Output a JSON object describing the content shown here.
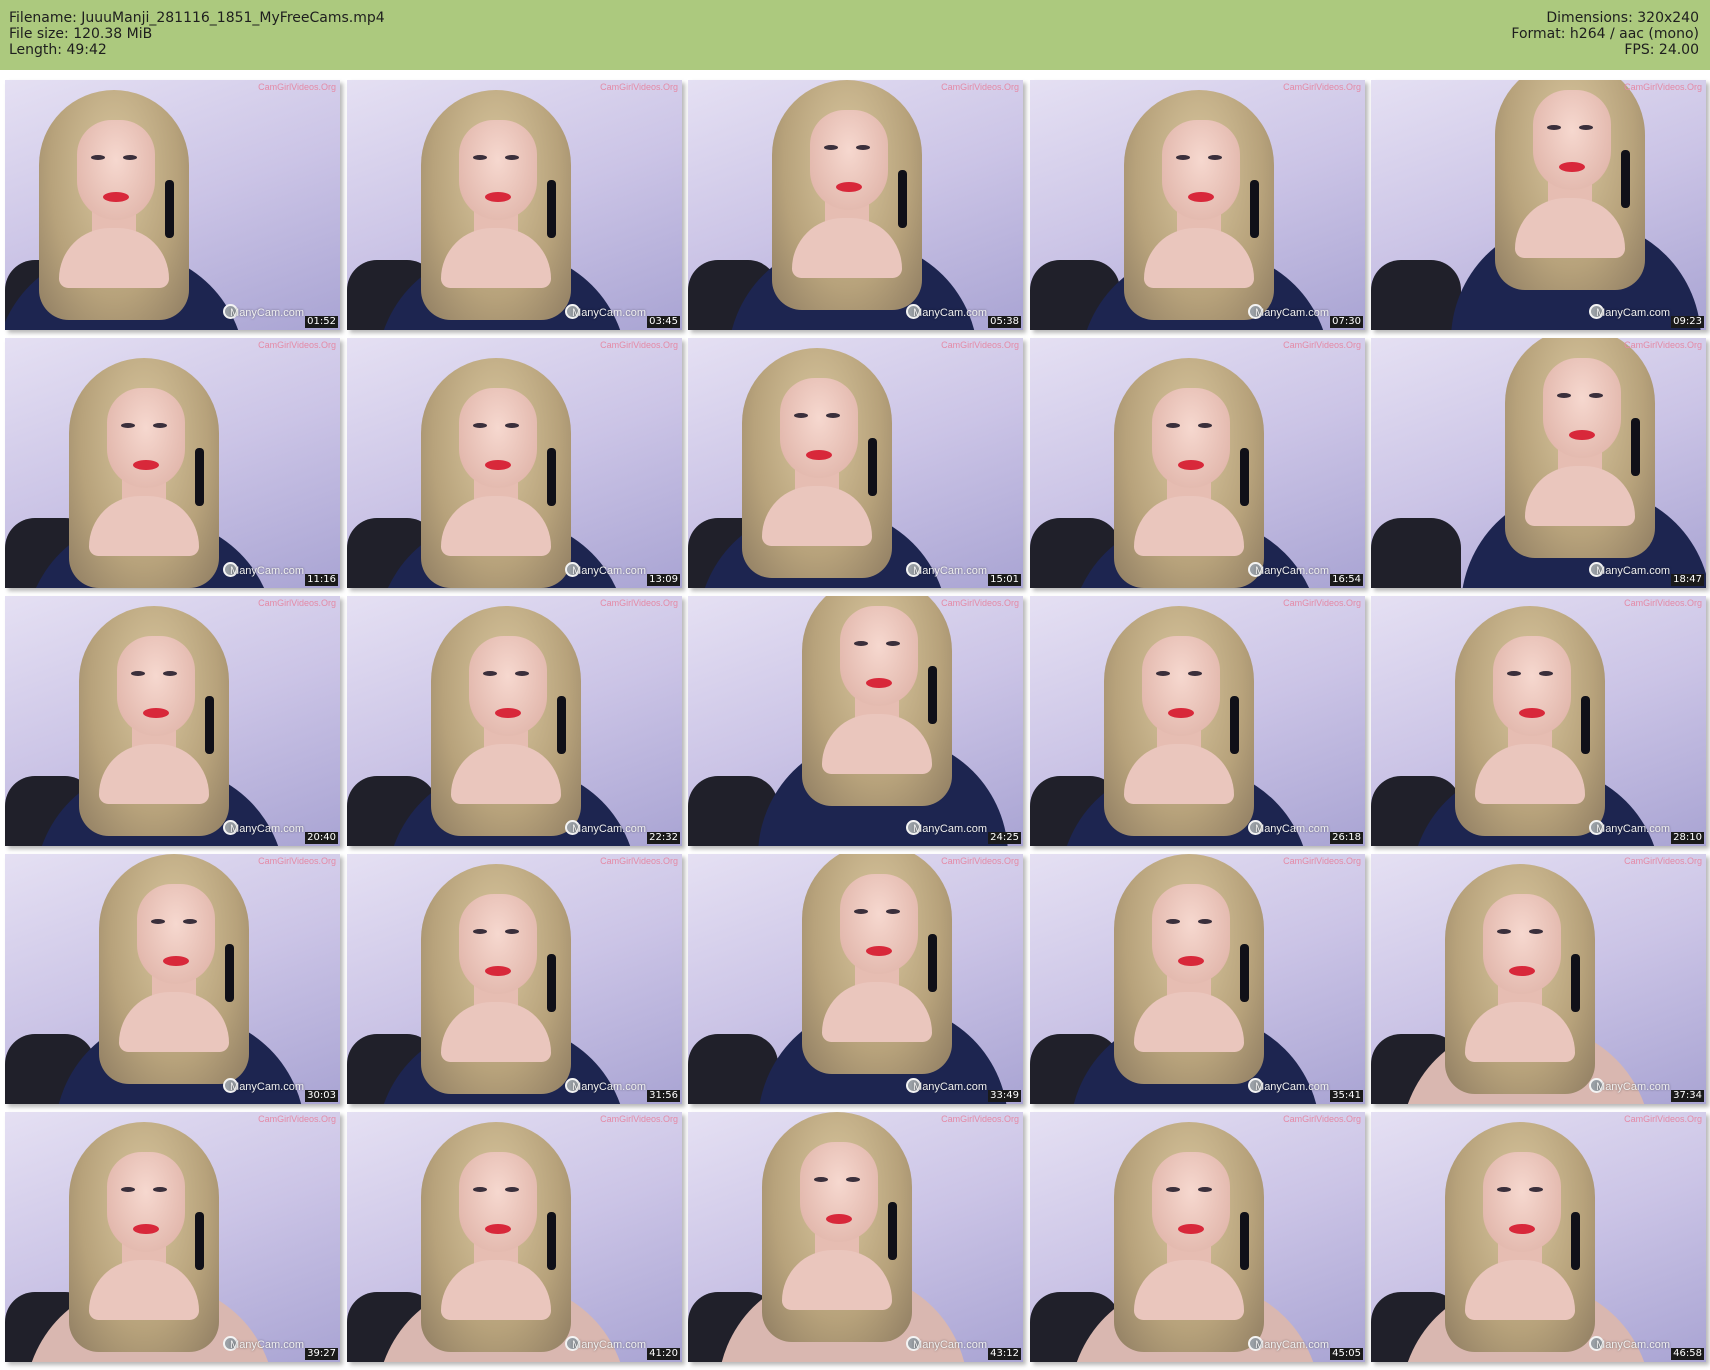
{
  "header": {
    "left": [
      "Filename: JuuuManji_281116_1851_MyFreeCams.mp4",
      "File size: 120.38 MiB",
      "Length: 49:42"
    ],
    "right": [
      "Dimensions: 320x240",
      "Format: h264 / aac (mono)",
      "FPS: 24.00"
    ]
  },
  "watermark_top": "CamGirlVideos.Org",
  "watermark_bottom": "ManyCam.com",
  "thumbnails": [
    {
      "time": "01:52"
    },
    {
      "time": "03:45"
    },
    {
      "time": "05:38"
    },
    {
      "time": "07:30"
    },
    {
      "time": "09:23"
    },
    {
      "time": "11:16"
    },
    {
      "time": "13:09"
    },
    {
      "time": "15:01"
    },
    {
      "time": "16:54"
    },
    {
      "time": "18:47"
    },
    {
      "time": "20:40"
    },
    {
      "time": "22:32"
    },
    {
      "time": "24:25"
    },
    {
      "time": "26:18"
    },
    {
      "time": "28:10"
    },
    {
      "time": "30:03"
    },
    {
      "time": "31:56"
    },
    {
      "time": "33:49"
    },
    {
      "time": "35:41"
    },
    {
      "time": "37:34"
    },
    {
      "time": "39:27"
    },
    {
      "time": "41:20"
    },
    {
      "time": "43:12"
    },
    {
      "time": "45:05"
    },
    {
      "time": "46:58"
    }
  ],
  "colors": {
    "header_bg": "#acc97e",
    "page_bg": "#ffffff"
  }
}
